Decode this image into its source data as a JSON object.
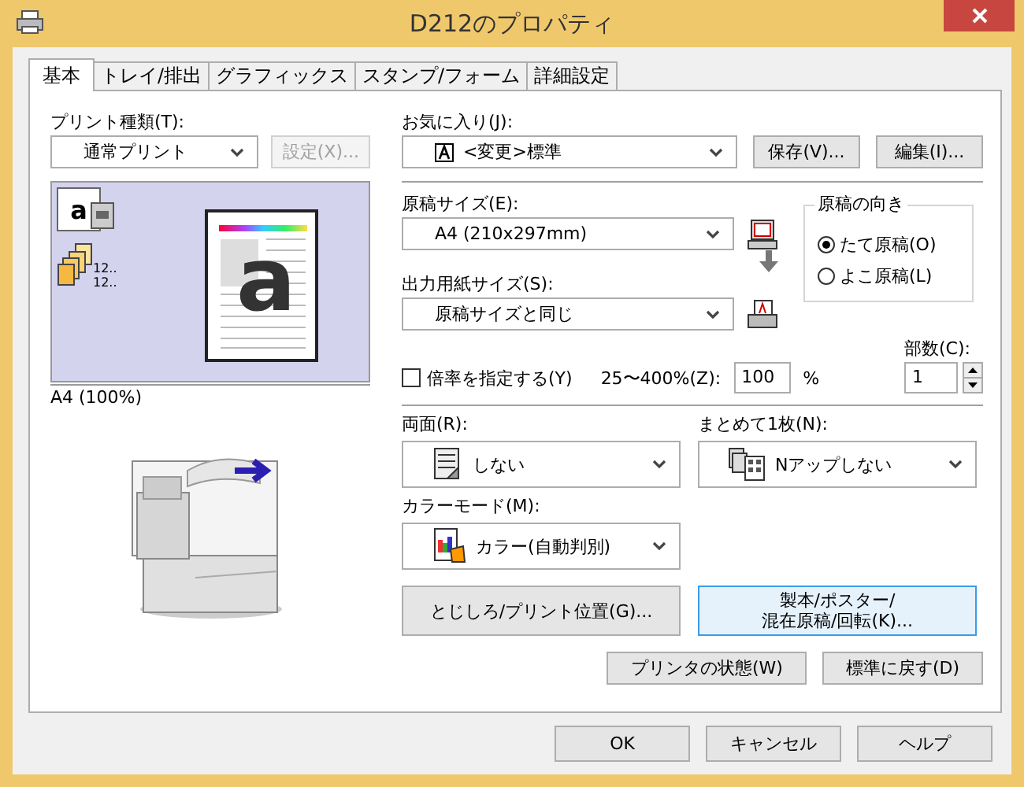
{
  "window": {
    "title": "D212のプロパティ"
  },
  "tabs": [
    {
      "label": "基本",
      "selected": true
    },
    {
      "label": "トレイ/排出",
      "selected": false
    },
    {
      "label": "グラフィックス",
      "selected": false
    },
    {
      "label": "スタンプ/フォーム",
      "selected": false
    },
    {
      "label": "詳細設定",
      "selected": false
    }
  ],
  "print_type": {
    "label": "プリント種類(T):",
    "value": "通常プリント",
    "settings_button": {
      "label": "設定(X)...",
      "disabled": true
    }
  },
  "preview": {
    "icon_letter": "a",
    "collate_labels": [
      "12..",
      "12.."
    ],
    "page_letter": "a",
    "caption": "A4 (100%)"
  },
  "favorites": {
    "label": "お気に入り(J):",
    "value": "<変更>標準",
    "buttons": [
      "保存(V)...",
      "編集(I)..."
    ]
  },
  "original_size": {
    "label": "原稿サイズ(E):",
    "value": "A4 (210x297mm)"
  },
  "output_size": {
    "label": "出力用紙サイズ(S):",
    "value": "原稿サイズと同じ"
  },
  "orientation": {
    "title": "原稿の向き",
    "options": [
      {
        "label": "たて原稿(O)",
        "selected": true
      },
      {
        "label": "よこ原稿(L)",
        "selected": false
      }
    ]
  },
  "scale": {
    "label": "倍率を指定する(Y)",
    "checked": false,
    "range_label": "25〜400%(Z):",
    "value": "100",
    "unit": "%"
  },
  "copies": {
    "label": "部数(C):",
    "value": "1"
  },
  "duplex": {
    "label": "両面(R):",
    "value": "しない"
  },
  "nup": {
    "label": "まとめて1枚(N):",
    "value": "Nアップしない"
  },
  "color_mode": {
    "label": "カラーモード(M):",
    "value": "カラー(自動判別)"
  },
  "action_buttons": [
    {
      "label": "とじしろ/プリント位置(G)...",
      "focused": false
    },
    {
      "label": "製本/ポスター/\n混在原稿/回転(K)...",
      "focused": true
    }
  ],
  "small_buttons": [
    "プリンタの状態(W)",
    "標準に戻す(D)"
  ],
  "dialog_buttons": [
    "OK",
    "キャンセル",
    "ヘルプ"
  ]
}
